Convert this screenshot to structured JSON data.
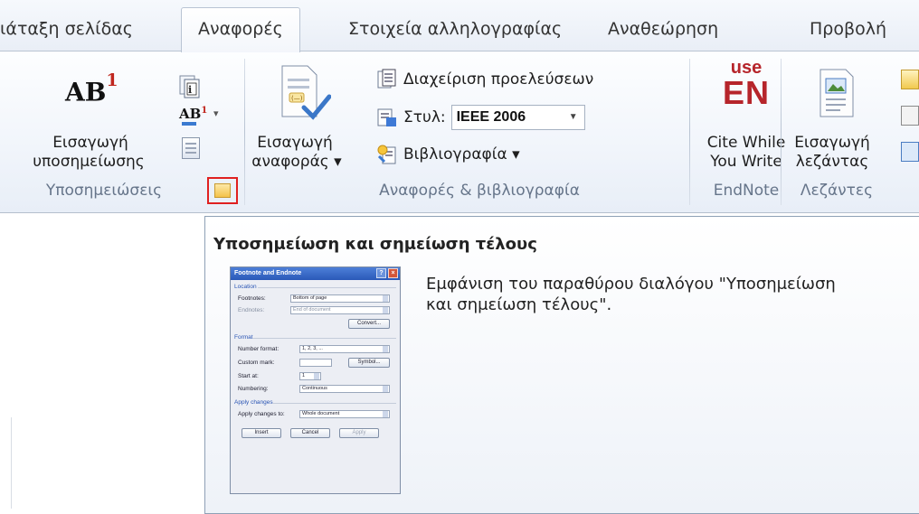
{
  "tabs": [
    {
      "label": "ιάταξη σελίδας",
      "active": false
    },
    {
      "label": "Αναφορές",
      "active": true
    },
    {
      "label": "Στοιχεία αλληλογραφίας",
      "active": false
    },
    {
      "label": "Αναθεώρηση",
      "active": false
    },
    {
      "label": "Προβολή",
      "active": false
    }
  ],
  "ribbon": {
    "footnotes_group": {
      "label": "Υποσημειώσεις",
      "insert_footnote_line1": "Εισαγωγή",
      "insert_footnote_line2": "υποσημείωσης"
    },
    "citations_group": {
      "label": "Αναφορές & βιβλιογραφία",
      "insert_citation_line1": "Εισαγωγή",
      "insert_citation_line2": "αναφοράς ▾",
      "manage_sources": "Διαχείριση προελεύσεων",
      "style_label": "Στυλ:",
      "style_value": "IEEE 2006",
      "bibliography": "Βιβλιογραφία ▾"
    },
    "endnote_group": {
      "label": "EndNote",
      "logo_top": "use",
      "logo_bottom": "EN",
      "cite_line1": "Cite While",
      "cite_line2": "You Write"
    },
    "captions_group": {
      "label": "Λεζάντες",
      "insert_caption_line1": "Εισαγωγή",
      "insert_caption_line2": "λεζάντας"
    }
  },
  "tooltip": {
    "title": "Υποσημείωση και σημείωση τέλους",
    "description_line1": "Εμφάνιση του παραθύρου διαλόγου \"Υποσημείωση",
    "description_line2": "και σημείωση τέλους\".",
    "preview": {
      "title": "Footnote and Endnote",
      "location_label": "Location",
      "footnotes_label": "Footnotes:",
      "footnotes_value": "Bottom of page",
      "endnotes_label": "Endnotes:",
      "endnotes_value": "End of document",
      "convert_button": "Convert...",
      "format_label": "Format",
      "number_format_label": "Number format:",
      "number_format_value": "1, 2, 3, ...",
      "custom_mark_label": "Custom mark:",
      "symbol_button": "Symbol...",
      "start_at_label": "Start at:",
      "start_at_value": "1",
      "numbering_label": "Numbering:",
      "numbering_value": "Continuous",
      "apply_changes_label": "Apply changes",
      "apply_to_label": "Apply changes to:",
      "apply_to_value": "Whole document",
      "insert_button": "Insert",
      "cancel_button": "Cancel",
      "apply_button": "Apply"
    }
  },
  "colors": {
    "accent_red": "#b6252b",
    "highlight_border": "#e02020",
    "group_label": "#66758a"
  }
}
